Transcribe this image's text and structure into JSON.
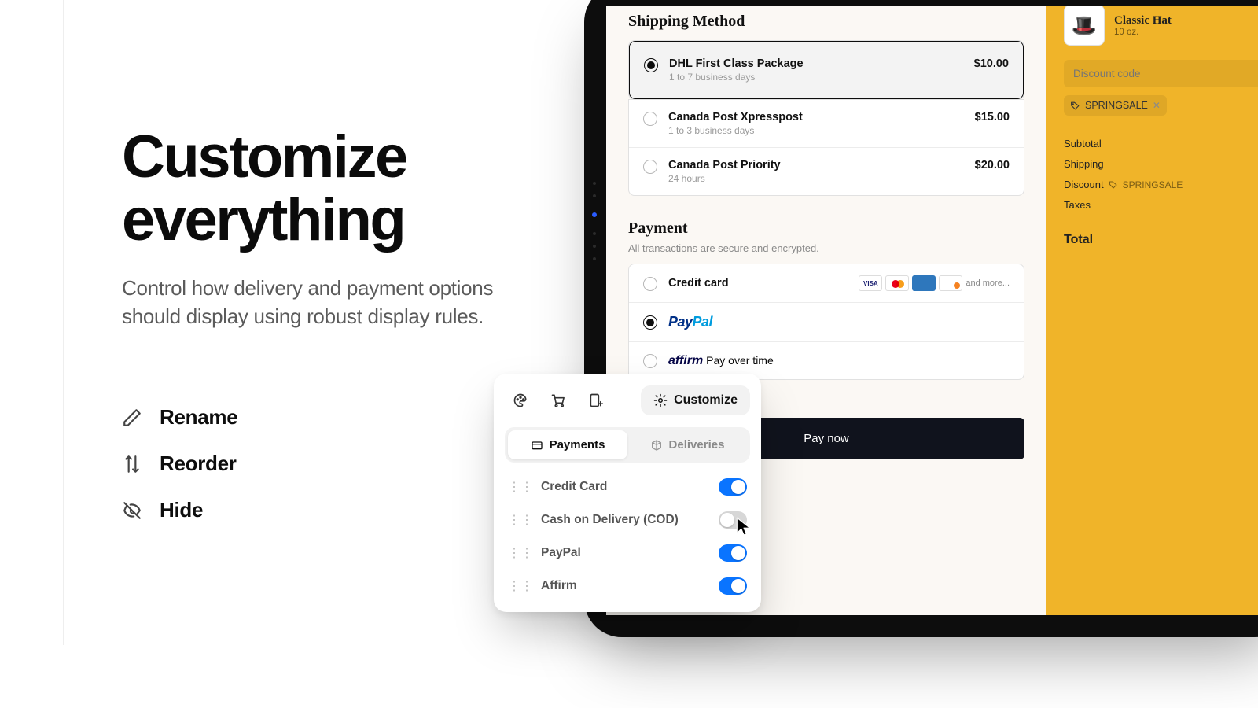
{
  "hero": {
    "headline_l1": "Customize",
    "headline_l2": "everything",
    "subhead": "Control how delivery and payment options should display using robust display rules.",
    "features": {
      "rename": "Rename",
      "reorder": "Reorder",
      "hide": "Hide"
    }
  },
  "checkout": {
    "shipping_title": "Shipping Method",
    "payment_title": "Payment",
    "payment_sub": "All transactions are secure and encrypted.",
    "pay_button": "Pay now",
    "and_more": "and more...",
    "methods": [
      {
        "title": "DHL First Class Package",
        "sub": "1 to 7 business days",
        "price": "$10.00",
        "selected": true
      },
      {
        "title": "Canada Post Xpresspost",
        "sub": "1 to 3 business days",
        "price": "$15.00",
        "selected": false
      },
      {
        "title": "Canada Post Priority",
        "sub": "24 hours",
        "price": "$20.00",
        "selected": false
      }
    ],
    "payment_options": {
      "credit_card": "Credit card",
      "affirm_suffix": "Pay over time"
    }
  },
  "summary": {
    "product_name": "Classic Hat",
    "product_sub": "10 oz.",
    "discount_placeholder": "Discount code",
    "discount_tag": "SPRINGSALE",
    "rows": {
      "subtotal": "Subtotal",
      "shipping": "Shipping",
      "discount": "Discount",
      "taxes": "Taxes",
      "total": "Total"
    }
  },
  "panel": {
    "customize": "Customize",
    "tabs": {
      "payments": "Payments",
      "deliveries": "Deliveries"
    },
    "items": [
      {
        "label": "Credit Card",
        "on": true
      },
      {
        "label": "Cash on Delivery (COD)",
        "on": false
      },
      {
        "label": "PayPal",
        "on": true
      },
      {
        "label": "Affirm",
        "on": true
      }
    ]
  }
}
